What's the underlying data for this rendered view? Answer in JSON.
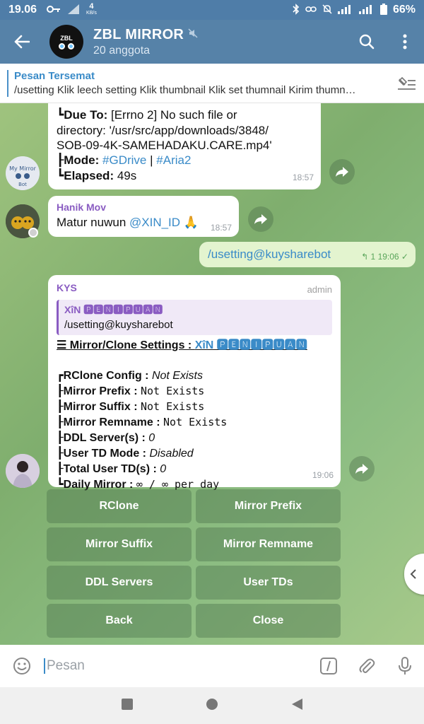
{
  "status": {
    "time": "19.06",
    "net_speed_top": "4",
    "net_speed_unit": "KB/s",
    "battery": "66%"
  },
  "header": {
    "avatar_text": "ZBL",
    "title": "ZBL MIRROR",
    "subtitle": "20 anggota"
  },
  "pinned": {
    "title": "Pesan Tersemat",
    "body": "/usetting   Klik leech setting Klik thumbnail Klik set thumnail Kirim thumn…"
  },
  "messages": {
    "m1": {
      "due_label": "Due To:",
      "due_text": " [Errno 2] No such file or",
      "line2": "directory: '/usr/src/app/downloads/3848/",
      "line3": "SOB-09-4K-SAMEHADAKU.CARE.mp4'",
      "mode_label": "Mode:",
      "mode_tag1": "#GDrive",
      "mode_sep": "|",
      "mode_tag2": "#Aria2",
      "elapsed_label": "Elapsed:",
      "elapsed_value": "49s",
      "time": "18:57"
    },
    "m2": {
      "sender": "Hanik Mov",
      "text": "Matur nuwun ",
      "mention": "@XIN_ID",
      "emoji": "🙏",
      "time": "18:57"
    },
    "m3": {
      "text": "/usetting@kuysharebot",
      "meta": "↰ 1  19:06  ✓"
    },
    "m4": {
      "sender": "KYS",
      "role": "admin",
      "quote_name": "XîN 🅿🅴🅽🅸🅿🆄🅰🅽",
      "quote_text": "/usetting@kuysharebot",
      "title_prefix": "☰ Mirror/Clone Settings : ",
      "title_mention": "XîN 🅿🅴🅽🅸🅿🆄🅰🅽",
      "rows": [
        {
          "k": "RClone Config : ",
          "v": "Not Exists",
          "style": "it"
        },
        {
          "k": "Mirror Prefix : ",
          "v": "Not Exists",
          "style": "mono"
        },
        {
          "k": "Mirror Suffix : ",
          "v": "Not Exists",
          "style": "mono"
        },
        {
          "k": "Mirror Remname : ",
          "v": "Not Exists",
          "style": "mono"
        },
        {
          "k": "DDL Server(s) : ",
          "v": "0",
          "style": "it"
        },
        {
          "k": "User TD Mode : ",
          "v": "Disabled",
          "style": "it"
        },
        {
          "k": "Total User TD(s) : ",
          "v": "0",
          "style": "it"
        },
        {
          "k": "Daily Mirror : ",
          "v": "∞  /  ∞ per day",
          "style": "mono"
        }
      ],
      "time": "19:06"
    }
  },
  "keyboard": [
    "RClone",
    "Mirror Prefix",
    "Mirror Suffix",
    "Mirror Remname",
    "DDL Servers",
    "User TDs",
    "Back",
    "Close"
  ],
  "input": {
    "placeholder": "Pesan"
  }
}
